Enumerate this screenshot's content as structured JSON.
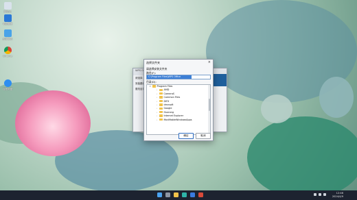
{
  "desktop": {
    "icons": [
      {
        "label": "回收站"
      },
      {
        "label": "电脑管家"
      },
      {
        "label": "应用商店"
      },
      {
        "label": "Chrome"
      },
      {
        "label": "百度网盘"
      }
    ]
  },
  "background_window": {
    "title": "WPS Office 安装",
    "labels": [
      "请选择",
      "安装路径",
      "更改目录"
    ]
  },
  "dialog": {
    "title": "选择文件夹",
    "prompt": "请选择安装文件夹",
    "folder_label": "路径(F):",
    "path_value": "C:\\Program Files\\WPS Office",
    "tree_label": "目录(D):",
    "tree": [
      {
        "name": "Program Files",
        "level": 0,
        "expanded": true
      },
      {
        "name": "AMD",
        "level": 1
      },
      {
        "name": "CameraS",
        "level": 1
      },
      {
        "name": "Common Files",
        "level": 1
      },
      {
        "name": "DIFX",
        "level": 1
      },
      {
        "name": "dmnsoft",
        "level": 1
      },
      {
        "name": "Google",
        "level": 1
      },
      {
        "name": "Huorong",
        "level": 1
      },
      {
        "name": "Internet Explorer",
        "level": 1
      },
      {
        "name": "ModifiableWindowsApps",
        "level": 1
      }
    ],
    "ok_label": "确定",
    "cancel_label": "取消"
  },
  "taskbar": {
    "time": "12:46",
    "date": "2024/4/9"
  },
  "colors": {
    "accent": "#3d7fd6",
    "taskbar": "#1d2330",
    "folder": "#f0c24b"
  }
}
